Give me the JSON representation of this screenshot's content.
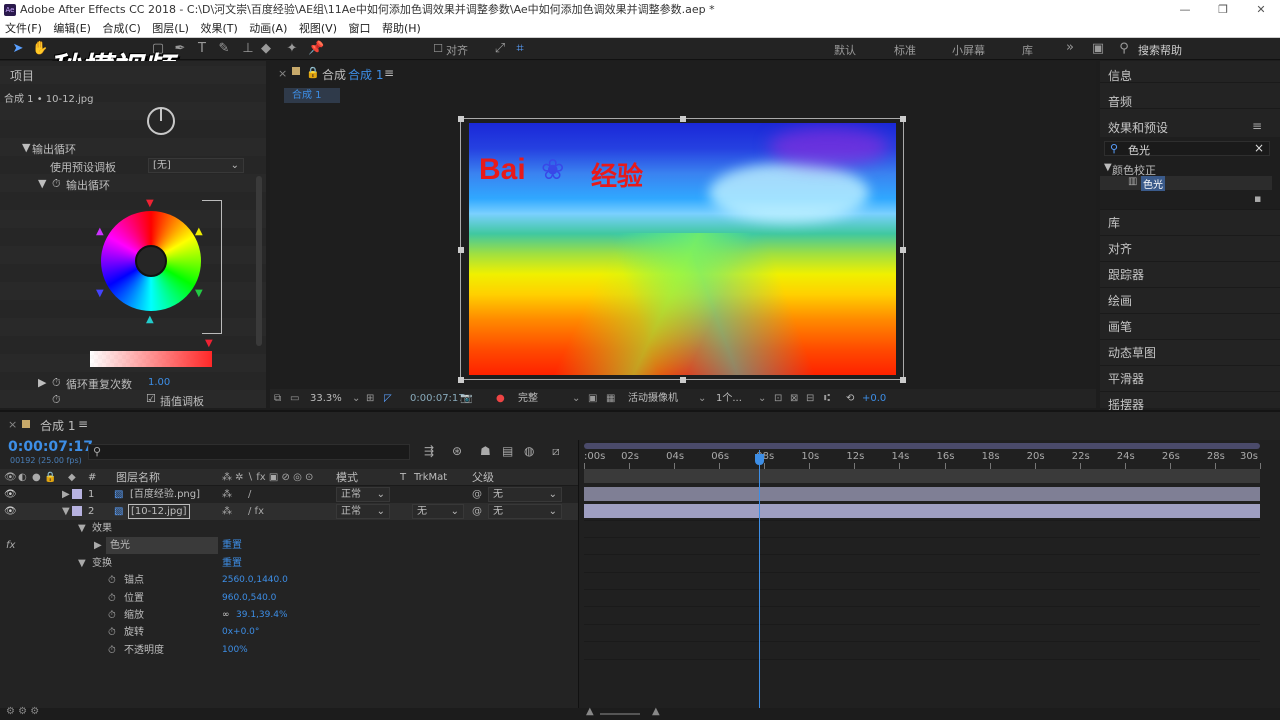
{
  "window": {
    "title": "Adobe After Effects CC 2018 - C:\\D\\河文崇\\百度经验\\AE组\\11Ae中如何添加色调效果并调整参数\\Ae中如何添加色调效果并调整参数.aep *",
    "app_icon": "Ae",
    "controls": [
      "—",
      "❐",
      "✕"
    ]
  },
  "menu": [
    "文件(F)",
    "编辑(E)",
    "合成(C)",
    "图层(L)",
    "效果(T)",
    "动画(A)",
    "视图(V)",
    "窗口",
    "帮助(H)"
  ],
  "toolbar": {
    "align_label": "对齐",
    "workspaces": [
      "默认",
      "标准",
      "小屏幕",
      "库"
    ],
    "more": "»",
    "search_placeholder": "搜索帮助"
  },
  "watermark": "秒懂视频",
  "left_panel": {
    "tab": "项目",
    "subtitle": "合成 1 • 10-12.jpg",
    "output_cycle_label": "输出循环",
    "preset_palette_label": "使用预设调板",
    "preset_palette_value": "[无]",
    "output_cycle_sub": "输出循环",
    "cycle_repeat_label": "循环重复次数",
    "cycle_repeat_value": "1.00",
    "interp_checkbox_label": "插值调板",
    "interp_checked": true
  },
  "comp_panel": {
    "tab_label": "合成",
    "tab_name": "合成 1",
    "subtab": "合成 1",
    "watermark_baidu": "Bai",
    "watermark_jingyan": "经验",
    "zoom": "33.3%",
    "timecode": "0:00:07:17",
    "resolution": "完整",
    "camera": "活动摄像机",
    "views": "1个...",
    "exposure": "+0.0"
  },
  "right_panel": {
    "info": "信息",
    "audio": "音频",
    "effects_presets": "效果和预设",
    "search_value": "色光",
    "category": "颜色校正",
    "effect_item": "色光",
    "items": [
      "库",
      "对齐",
      "跟踪器",
      "绘画",
      "画笔",
      "动态草图",
      "平滑器",
      "摇摆器"
    ]
  },
  "timeline": {
    "tab": "合成 1",
    "timecode": "0:00:07:17",
    "frames": "00192 (25.00 fps)",
    "search_placeholder": "",
    "columns": {
      "num": "#",
      "layer_name": "图层名称",
      "mode": "模式",
      "t": "T",
      "trkmat": "TrkMat",
      "parent": "父级"
    },
    "ruler": [
      ":00s",
      "02s",
      "04s",
      "06s",
      "08s",
      "10s",
      "12s",
      "14s",
      "16s",
      "18s",
      "20s",
      "22s",
      "24s",
      "26s",
      "28s",
      "30s"
    ],
    "layers": [
      {
        "num": "1",
        "name": "[百度经验.png]",
        "mode": "正常",
        "trkmat": "",
        "parent": "无"
      },
      {
        "num": "2",
        "name": "[10-12.jpg]",
        "mode": "正常",
        "trkmat": "无",
        "parent": "无"
      }
    ],
    "effects_label": "效果",
    "effect_name": "色光",
    "reset": "重置",
    "transform_label": "变换",
    "transform_reset": "重置",
    "props": [
      {
        "name": "锚点",
        "value": "2560.0,1440.0"
      },
      {
        "name": "位置",
        "value": "960.0,540.0"
      },
      {
        "name": "缩放",
        "value": "39.1,39.4%"
      },
      {
        "name": "旋转",
        "value": "0x+0.0°"
      },
      {
        "name": "不透明度",
        "value": "100%"
      }
    ],
    "playhead_fraction": 0.2589
  }
}
